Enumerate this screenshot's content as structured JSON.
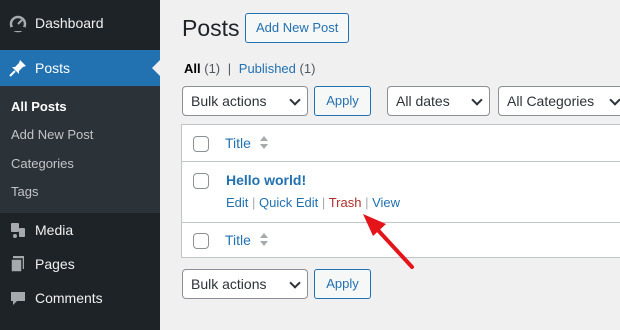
{
  "sidebar": {
    "items": [
      {
        "label": "Dashboard",
        "icon": "dashboard-icon"
      },
      {
        "label": "Posts",
        "icon": "pin-icon"
      },
      {
        "label": "Media",
        "icon": "media-icon"
      },
      {
        "label": "Pages",
        "icon": "pages-icon"
      },
      {
        "label": "Comments",
        "icon": "comments-icon"
      }
    ],
    "submenu": [
      "All Posts",
      "Add New Post",
      "Categories",
      "Tags"
    ]
  },
  "header": {
    "title": "Posts",
    "add_new": "Add New Post"
  },
  "filters": {
    "all_label": "All",
    "all_count": "(1)",
    "separator": "|",
    "published_label": "Published",
    "published_count": "(1)"
  },
  "toolbar": {
    "bulk_actions": "Bulk actions",
    "apply": "Apply",
    "dates": "All dates",
    "categories": "All Categories"
  },
  "table": {
    "column_title": "Title",
    "post_title": "Hello world!",
    "row_actions": {
      "edit": "Edit",
      "quick_edit": "Quick Edit",
      "trash": "Trash",
      "view": "View",
      "sep": "|"
    }
  },
  "colors": {
    "sidebar": "#1d2327",
    "accent": "#2271b1",
    "trash": "#b32d2e",
    "arrow": "#e4141b"
  }
}
